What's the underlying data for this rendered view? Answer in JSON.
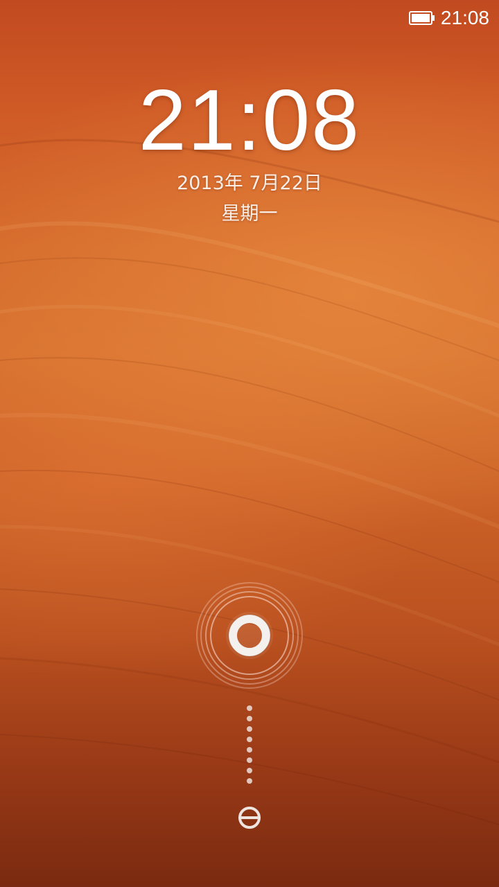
{
  "status_bar": {
    "time": "21:08",
    "battery_icon": "battery-full-icon"
  },
  "lockscreen": {
    "clock": "21:08",
    "date": "2013年 7月22日",
    "weekday": "星期一"
  },
  "unlock": {
    "handle_icon": "unlock-ring-icon",
    "track_icon": "dotted-track-icon",
    "target_icon": "unlock-target-icon"
  },
  "colors": {
    "background_top": "#c24a20",
    "background_mid": "#d5702f",
    "background_bottom": "#7a2a10",
    "text": "#ffffff"
  }
}
